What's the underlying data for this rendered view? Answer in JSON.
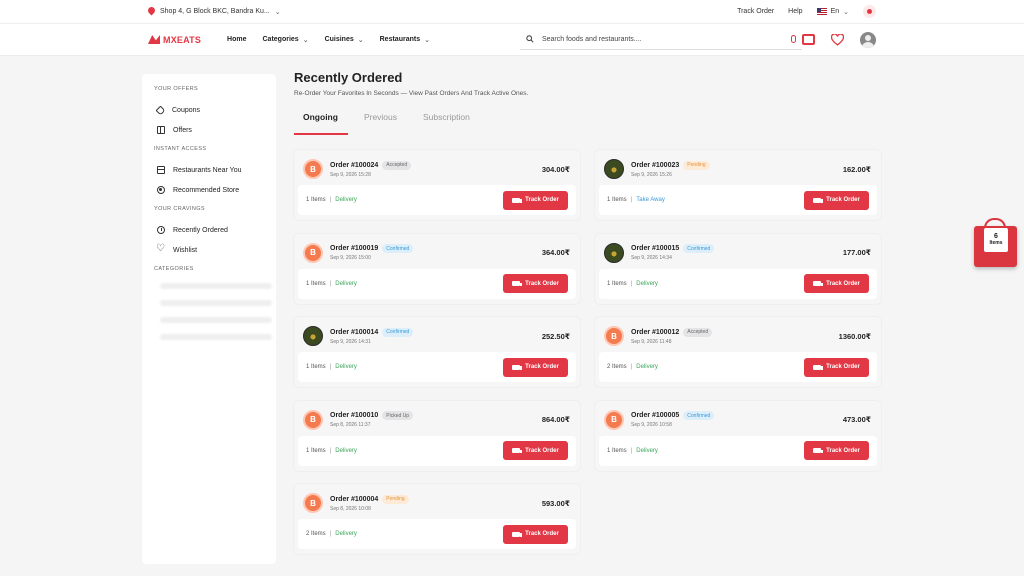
{
  "topbar": {
    "location": "Shop 4, G Block BKC, Bandra Ku...",
    "track_order": "Track Order",
    "help": "Help",
    "language": "En"
  },
  "navbar": {
    "brand": "MXEATS",
    "links": [
      "Home",
      "Categories",
      "Cuisines",
      "Restaurants"
    ],
    "search_placeholder": "Search foods and restaurants...."
  },
  "sidebar": {
    "sections": [
      {
        "title": "YOUR OFFERS",
        "items": [
          {
            "label": "Coupons",
            "icon": "tag-icon"
          },
          {
            "label": "Offers",
            "icon": "gift-icon"
          }
        ]
      },
      {
        "title": "INSTANT ACCESS",
        "items": [
          {
            "label": "Restaurants Near You",
            "icon": "calendar-icon"
          },
          {
            "label": "Recommended Store",
            "icon": "record-icon"
          }
        ]
      },
      {
        "title": "YOUR CRAVINGS",
        "items": [
          {
            "label": "Recently Ordered",
            "icon": "history-icon"
          },
          {
            "label": "Wishlist",
            "icon": "heart-outline-icon"
          }
        ]
      },
      {
        "title": "CATEGORIES",
        "items": []
      }
    ]
  },
  "page": {
    "title": "Recently Ordered",
    "subtitle": "Re-Order Your Favorites In Seconds — View Past Orders And Track Active Ones.",
    "tabs": [
      "Ongoing",
      "Previous",
      "Subscription"
    ],
    "active_tab": "Ongoing"
  },
  "orders": [
    {
      "id": "Order #100024",
      "status": "Accepted",
      "date": "Sep 9, 2026 15:28",
      "amount": "304.00₹",
      "items": "1 Items",
      "type": "Delivery",
      "logo": "b",
      "button": "Track Order"
    },
    {
      "id": "Order #100023",
      "status": "Pending",
      "date": "Sep 9, 2026 15:26",
      "amount": "162.00₹",
      "items": "1 Items",
      "type": "Take Away",
      "logo": "d",
      "button": "Track Order"
    },
    {
      "id": "Order #100019",
      "status": "Confirmed",
      "date": "Sep 9, 2026 15:00",
      "amount": "364.00₹",
      "items": "1 Items",
      "type": "Delivery",
      "logo": "b",
      "button": "Track Order"
    },
    {
      "id": "Order #100015",
      "status": "Confirmed",
      "date": "Sep 9, 2026 14:34",
      "amount": "177.00₹",
      "items": "1 Items",
      "type": "Delivery",
      "logo": "d",
      "button": "Track Order"
    },
    {
      "id": "Order #100014",
      "status": "Confirmed",
      "date": "Sep 9, 2026 14:31",
      "amount": "252.50₹",
      "items": "1 Items",
      "type": "Delivery",
      "logo": "d",
      "button": "Track Order"
    },
    {
      "id": "Order #100012",
      "status": "Accepted",
      "date": "Sep 9, 2026 11:48",
      "amount": "1360.00₹",
      "items": "2 Items",
      "type": "Delivery",
      "logo": "b",
      "button": "Track Order"
    },
    {
      "id": "Order #100010",
      "status": "Picked Up",
      "date": "Sep 8, 2026 11:37",
      "amount": "864.00₹",
      "items": "1 Items",
      "type": "Delivery",
      "logo": "b",
      "button": "Track Order"
    },
    {
      "id": "Order #100005",
      "status": "Confirmed",
      "date": "Sep 9, 2026 10:58",
      "amount": "473.00₹",
      "items": "1 Items",
      "type": "Delivery",
      "logo": "b",
      "button": "Track Order"
    },
    {
      "id": "Order #100004",
      "status": "Pending",
      "date": "Sep 8, 2026 10:08",
      "amount": "593.00₹",
      "items": "2 Items",
      "type": "Delivery",
      "logo": "b",
      "button": "Track Order"
    }
  ],
  "cart": {
    "count": "6",
    "label": "Items"
  },
  "colors": {
    "accent": "#e23744",
    "delivery": "#3aa65a",
    "takeaway": "#3a9ad9"
  }
}
